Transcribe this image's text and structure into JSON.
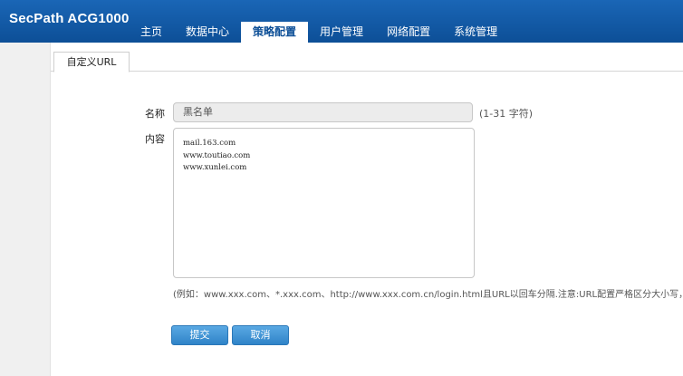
{
  "brand": "SecPath ACG1000",
  "nav": [
    {
      "label": "主页"
    },
    {
      "label": "数据中心"
    },
    {
      "label": "策略配置",
      "active": true
    },
    {
      "label": "用户管理"
    },
    {
      "label": "网络配置"
    },
    {
      "label": "系统管理"
    }
  ],
  "tab": {
    "label": "自定义URL"
  },
  "form": {
    "name_label": "名称",
    "name_value": "黑名单",
    "name_hint": "(1-31 字符)",
    "content_label": "内容",
    "content_lines": [
      "mail.163.com",
      "www.toutiao.com",
      "www.xunlei.com"
    ],
    "example_hint": "(例如：www.xxx.com、*.xxx.com、http://www.xxx.com.cn/login.html且URL以回车分隔.注意:URL配置严格区分大小写，符号"
  },
  "buttons": {
    "submit": "提交",
    "cancel": "取消"
  },
  "colors": {
    "header": "#1a66b6",
    "button": "#3c8fd1"
  }
}
